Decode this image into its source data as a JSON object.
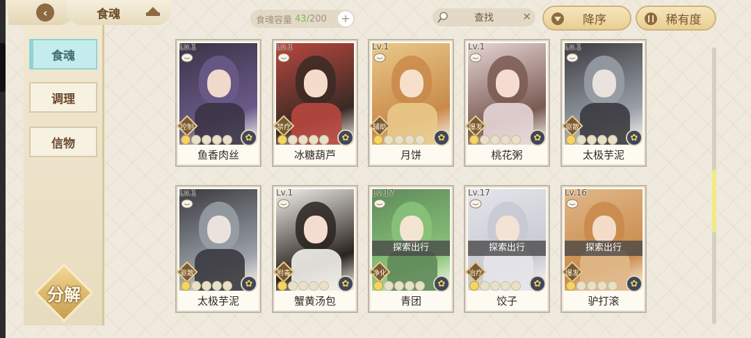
{
  "header": {
    "title": "食魂",
    "capacity_label": "食魂容量",
    "capacity_current": "43",
    "capacity_total": "/200",
    "search_label": "查找",
    "sort_desc_label": "降序",
    "rarity_label": "稀有度"
  },
  "sidebar": {
    "items": [
      {
        "label": "食魂",
        "active": true
      },
      {
        "label": "调理",
        "active": false
      },
      {
        "label": "信物",
        "active": false
      }
    ],
    "split_label": "分解"
  },
  "cards": [
    {
      "level": "Lv.1",
      "name": "鱼香肉丝",
      "role": "控制",
      "stars_filled": 1,
      "explore": ""
    },
    {
      "level": "Lv.1",
      "name": "冰糖葫芦",
      "role": "禁疗",
      "stars_filled": 1,
      "explore": ""
    },
    {
      "level": "Lv.1",
      "name": "月饼",
      "role": "辅助",
      "stars_filled": 1,
      "explore": ""
    },
    {
      "level": "Lv.1",
      "name": "桃花粥",
      "role": "爆发",
      "stars_filled": 1,
      "explore": ""
    },
    {
      "level": "Lv.1",
      "name": "太极芋泥",
      "role": "驱散",
      "stars_filled": 1,
      "explore": ""
    },
    {
      "level": "Lv.1",
      "name": "太极芋泥",
      "role": "驱散",
      "stars_filled": 1,
      "explore": ""
    },
    {
      "level": "Lv.1",
      "name": "蟹黄汤包",
      "role": "附毒",
      "stars_filled": 1,
      "explore": ""
    },
    {
      "level": "Lv.17",
      "name": "青团",
      "role": "净化",
      "stars_filled": 1,
      "explore": "探索出行"
    },
    {
      "level": "Lv.17",
      "name": "饺子",
      "role": "治疗",
      "stars_filled": 1,
      "explore": "探索出行"
    },
    {
      "level": "Lv.16",
      "name": "驴打滚",
      "role": "爆发",
      "stars_filled": 1,
      "explore": "探索出行"
    }
  ],
  "colors": {
    "accent_active": "#c5ecec",
    "capacity_current": "#79c04a",
    "gold": "#e8cf93"
  }
}
